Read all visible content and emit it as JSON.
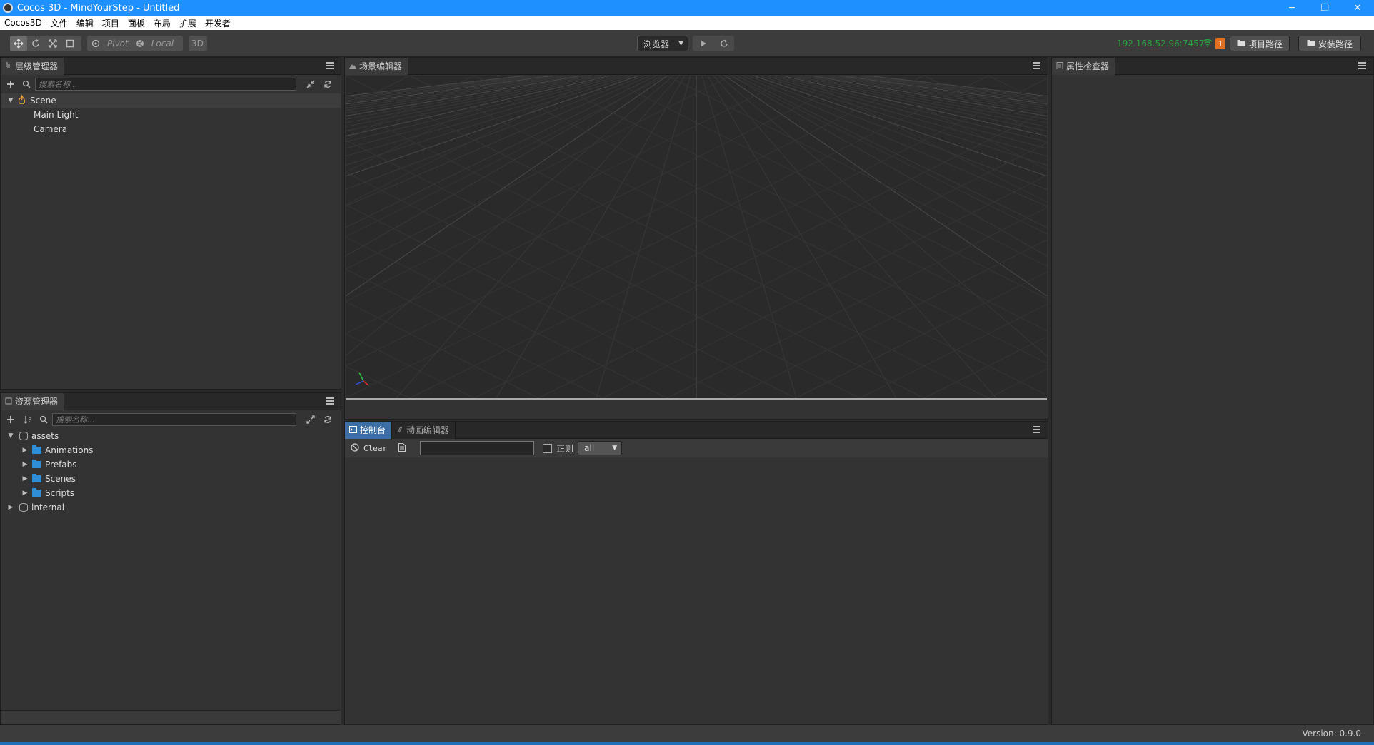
{
  "window": {
    "title": "Cocos 3D - MindYourStep - Untitled",
    "minimize": "─",
    "restore": "❐",
    "close": "✕"
  },
  "menu": [
    "Cocos3D",
    "文件",
    "编辑",
    "项目",
    "面板",
    "布局",
    "扩展",
    "开发者"
  ],
  "toolbar": {
    "pivot_label": "Pivot",
    "local_label": "Local",
    "mode_3d_label": "3D",
    "preview_target": "浏览器",
    "ip_address": "192.168.52.96:7457",
    "notification_count": "1",
    "project_path_label": "项目路径",
    "install_path_label": "安装路径"
  },
  "hierarchy": {
    "tab_label": "层级管理器",
    "search_placeholder": "搜索名称...",
    "root": "Scene",
    "children": [
      "Main Light",
      "Camera"
    ]
  },
  "assets": {
    "tab_label": "资源管理器",
    "search_placeholder": "搜索名称...",
    "root": "assets",
    "folders": [
      "Animations",
      "Prefabs",
      "Scenes",
      "Scripts"
    ],
    "internal": "internal"
  },
  "scene": {
    "tab_label": "场景编辑器"
  },
  "inspector": {
    "tab_label": "属性检查器"
  },
  "console": {
    "tab_console": "控制台",
    "tab_animation": "动画编辑器",
    "clear_label": "Clear",
    "regex_label": "正则",
    "filter_level": "all"
  },
  "status": {
    "version": "Version: 0.9.0"
  },
  "colors": {
    "titlebar": "#1e90ff",
    "ip_text": "#2aa040",
    "badge": "#e07020",
    "folder": "#2e8fd8",
    "active_tab": "#3a6ea5"
  }
}
